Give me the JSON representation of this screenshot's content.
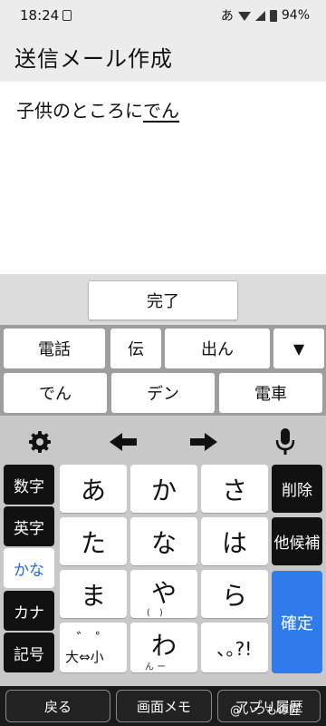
{
  "status": {
    "time": "18:24",
    "ime_indicator": "あ",
    "battery": "94%"
  },
  "header": {
    "title": "送信メール作成"
  },
  "compose": {
    "committed_text": "子供のところに",
    "composing_text": "でん"
  },
  "done_button": "完了",
  "candidates": {
    "row1": [
      "電話",
      "伝",
      "出ん"
    ],
    "row2": [
      "でん",
      "デン",
      "電車"
    ],
    "expand_icon": "▼"
  },
  "keyboard": {
    "modes": [
      "数字",
      "英字",
      "かな",
      "カナ",
      "記号"
    ],
    "active_mode": "かな",
    "keys": {
      "a": "あ",
      "ka": "か",
      "sa": "さ",
      "ta": "た",
      "na": "な",
      "ha": "は",
      "ma": "ま",
      "ya": "や",
      "ra": "ら",
      "ya_sub": "(　)",
      "dakuten": "゛ ゜",
      "dakuten_sub": "大⇔小",
      "wa": "わ",
      "wa_sub": "ん ー",
      "punct": "､｡?!"
    },
    "delete_label": "削除",
    "other_candidates_label": "他候補",
    "confirm_label": "確定"
  },
  "bottom_nav": {
    "back": "戻る",
    "memo": "画面メモ",
    "recent": "アプリ履歴"
  },
  "watermark": "@いつもの匠",
  "colors": {
    "accent": "#2f7bec",
    "mode_active_text": "#2a6bd6"
  }
}
